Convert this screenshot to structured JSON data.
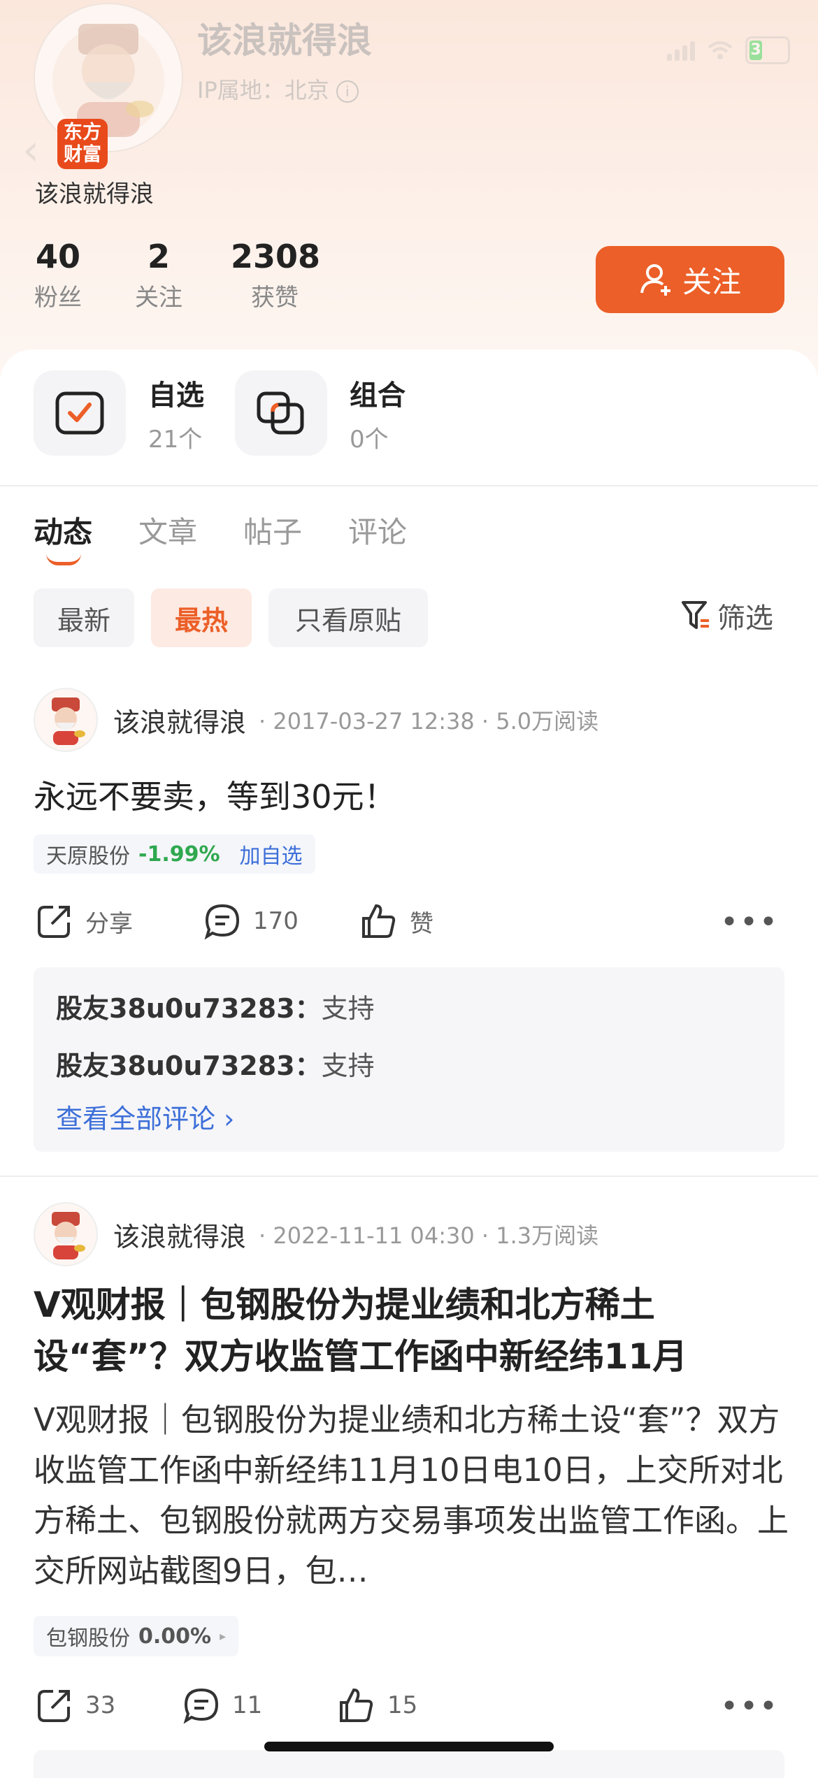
{
  "status_bar": {
    "battery": "3"
  },
  "header": {
    "ghost_name": "该浪就得浪",
    "ghost_ip": "IP属地：北京",
    "badge": "东方\n财富",
    "username": "该浪就得浪"
  },
  "stats": [
    {
      "value": "40",
      "label": "粉丝"
    },
    {
      "value": "2",
      "label": "关注"
    },
    {
      "value": "2308",
      "label": "获赞"
    }
  ],
  "follow_label": "关注",
  "shortcuts": [
    {
      "title": "自选",
      "sub": "21个"
    },
    {
      "title": "组合",
      "sub": "0个"
    }
  ],
  "tabs": [
    "动态",
    "文章",
    "帖子",
    "评论"
  ],
  "filters": [
    "最新",
    "最热",
    "只看原贴"
  ],
  "filter_right": "筛选",
  "posts": [
    {
      "author": "该浪就得浪",
      "meta": "· 2017-03-27 12:38 · 5.0万阅读",
      "title": "永远不要卖，等到30元！",
      "stock": {
        "name": "天原股份",
        "change": "-1.99%",
        "add": "加自选"
      },
      "actions": {
        "share": "分享",
        "comments": "170",
        "like": "赞"
      },
      "comments": [
        {
          "user": "股友38u0u73283：",
          "text": "支持"
        },
        {
          "user": "股友38u0u73283：",
          "text": "支持"
        }
      ],
      "view_all": "查看全部评论 ›"
    },
    {
      "author": "该浪就得浪",
      "meta": "· 2022-11-11 04:30 · 1.3万阅读",
      "title": "V观财报｜包钢股份为提业绩和北方稀土设“套”？双方收监管工作函中新经纬11月",
      "body": "V观财报｜包钢股份为提业绩和北方稀土设“套”？双方收监管工作函中新经纬11月10日电10日，上交所对北方稀土、包钢股份就两方交易事项发出监管工作函。上交所网站截图9日，包…",
      "stock": {
        "name": "包钢股份",
        "change": "0.00%",
        "arrow": "▸"
      },
      "actions": {
        "share": "33",
        "comments": "11",
        "like": "15"
      }
    }
  ],
  "colors": {
    "accent": "#ec5f28",
    "link": "#3d6fd9",
    "down": "#2fa84f"
  }
}
